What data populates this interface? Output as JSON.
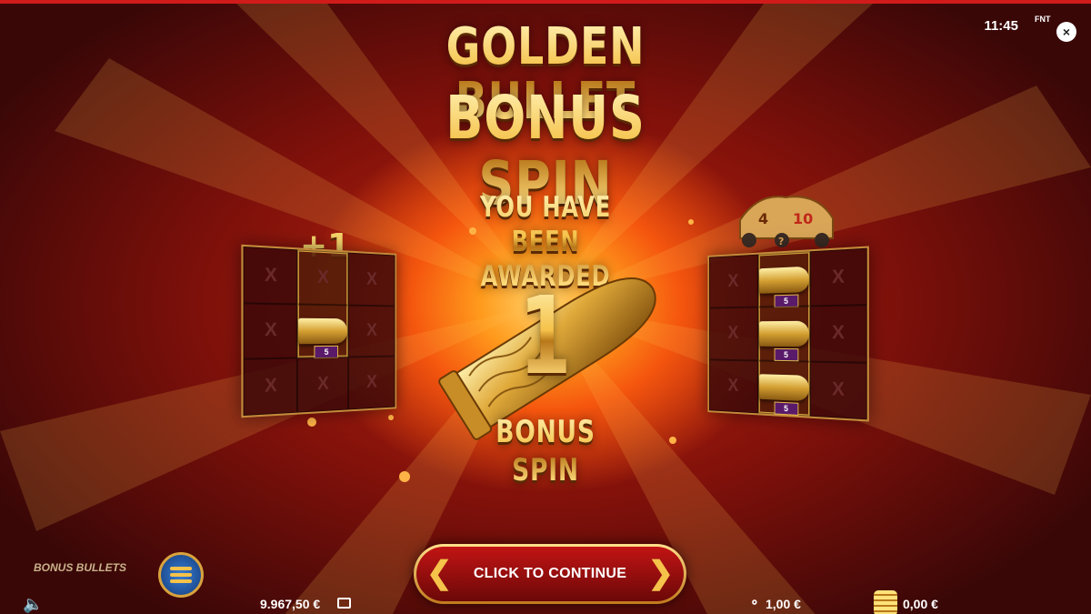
{
  "header": {
    "clock": "11:45",
    "logo_text": "FNT",
    "close_label": "×"
  },
  "title": {
    "line1": "GOLDEN BULLET",
    "line2": "BONUS SPIN"
  },
  "award": {
    "line1": "YOU HAVE BEEN",
    "line2": "AWARDED",
    "count": "1",
    "label": "BONUS SPIN"
  },
  "left_reel": {
    "badge": "+1",
    "bullet_value": "5",
    "x_symbol": "X"
  },
  "right_reel": {
    "meter_left": "4",
    "meter_right": "10",
    "meter_mystery": "?",
    "bullet_values": [
      "5",
      "5",
      "5"
    ]
  },
  "continue_button": {
    "label": "CLICK TO CONTINUE"
  },
  "footer": {
    "feature_label": "BONUS BULLETS",
    "balance": "9.967,50 €",
    "bet": "1,00 €",
    "win": "0,00 €"
  },
  "colors": {
    "accent_gold": "#f5c24a",
    "button_red": "#c21414",
    "frame_red": "#d11b1b"
  },
  "icons": [
    "speaker-icon",
    "wallet-icon",
    "bet-chips-icon",
    "coin-stack-icon",
    "menu-icon",
    "close-icon",
    "chevron-left-icon",
    "chevron-right-icon"
  ]
}
